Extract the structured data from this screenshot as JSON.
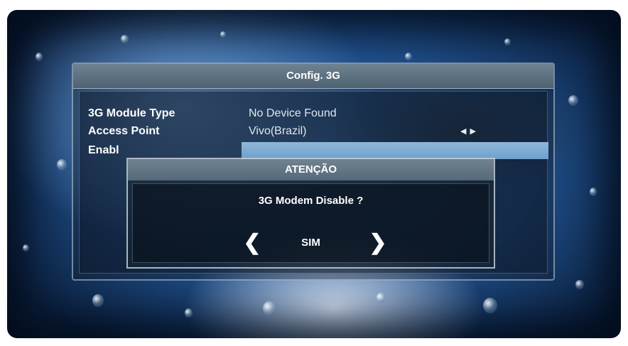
{
  "config": {
    "title": "Config. 3G",
    "rows": [
      {
        "label": "3G Module Type",
        "value": "No Device Found"
      },
      {
        "label": "Access Point",
        "value": "Vivo(Brazil)",
        "arrows": "◀ ▶"
      },
      {
        "label": "Enabl",
        "value": ""
      }
    ]
  },
  "dialog": {
    "title": "ATENÇÃO",
    "message": "3G Modem Disable ?",
    "left_icon": "chevron-left-icon",
    "right_icon": "chevron-right-icon",
    "left_glyph": "❮",
    "right_glyph": "❯",
    "option": "SIM"
  },
  "colors": {
    "highlight": "#7eabd2",
    "panel_border": "#c8d7e6"
  }
}
